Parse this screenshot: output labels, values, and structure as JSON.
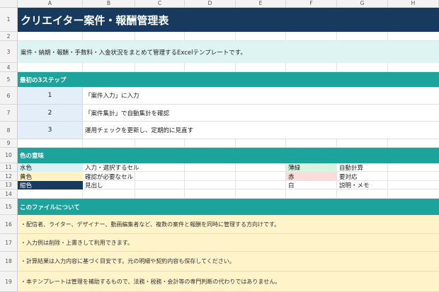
{
  "columns": [
    "A",
    "B",
    "C",
    "D",
    "E",
    "F",
    "G",
    "H"
  ],
  "rows": [
    "1",
    "2",
    "3",
    "4",
    "5",
    "6",
    "7",
    "8",
    "9",
    "10",
    "11",
    "12",
    "13",
    "14",
    "15",
    "16",
    "17",
    "18",
    "19"
  ],
  "title": "クリエイター案件・報酬管理表",
  "subtitle": "案件・納期・報酬・手数料・入金状況をまとめて管理するExcelテンプレートです。",
  "steps_header": "最初の3ステップ",
  "steps": [
    {
      "num": "1",
      "text": "「案件入力」に入力"
    },
    {
      "num": "2",
      "text": "「案件集計」で自動集計を確認"
    },
    {
      "num": "3",
      "text": "運用チェックを更新し、定期的に見直す"
    }
  ],
  "colors_header": "色の意味",
  "colors": [
    {
      "name": "水色",
      "meaning": "入力・選択するセル",
      "name2": "薄緑",
      "meaning2": "自動計算",
      "color": "#d9f1f7",
      "color2": "#d8f3e0"
    },
    {
      "name": "黄色",
      "meaning": "確認が必要なセル",
      "name2": "赤",
      "meaning2": "要対応",
      "color": "#fff2c4",
      "color2": "#fbdcdc"
    },
    {
      "name": "紺色",
      "meaning": "見出し",
      "name2": "白",
      "meaning2": "説明・メモ",
      "color": "#173a5e",
      "color2": "#ffffff"
    }
  ],
  "file_header": "このファイルについて",
  "notes": [
    "・配信者、ライター、デザイナー、動画編集者など、複数の案件と報酬を同時に管理する方向けです。",
    "・入力例は削除・上書きして利用できます。",
    "・計算結果は入力内容に基づく目安です。元の明細や契約内容も保存してください。",
    "・本テンプレートは管理を補助するもので、法務・税務・会計等の専門判断の代わりではありません。"
  ],
  "palette": {
    "navy": "#173a5e",
    "teal": "#1ba39c",
    "mint": "#def4f3",
    "note": "#fff3c9",
    "step": "#e3eef8"
  }
}
